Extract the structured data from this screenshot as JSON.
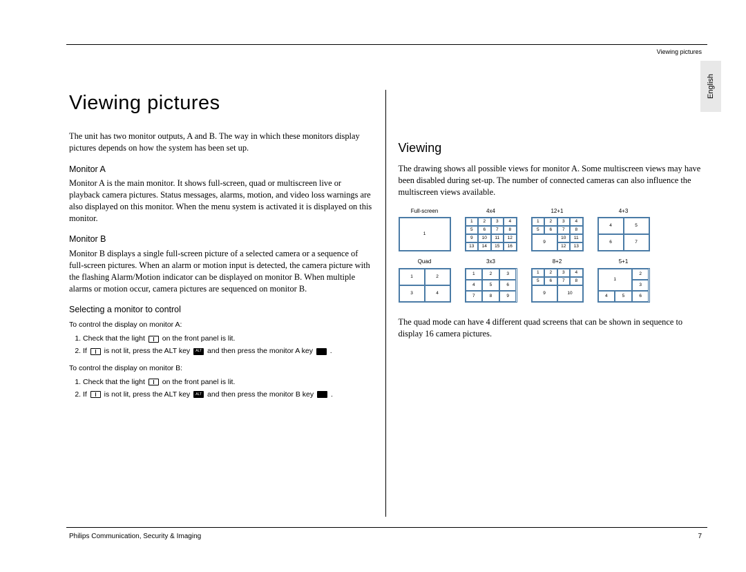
{
  "header": {
    "running": "Viewing pictures",
    "lang_tab": "English"
  },
  "left": {
    "h1": "Viewing pictures",
    "intro": "The unit has two monitor outputs, A and B. The way in which these monitors display pictures depends on how the system has been set up.",
    "ma": {
      "h": "Monitor A",
      "p": "Monitor A is the main monitor. It shows full-screen, quad or multiscreen live or playback camera pictures. Status messages, alarms, motion, and video loss warnings are also displayed on this monitor. When the menu system is activated it is displayed on this monitor."
    },
    "mb": {
      "h": "Monitor B",
      "p": "Monitor B displays a single full-screen picture of a selected camera or a sequence of full-screen pictures. When an alarm or motion input is detected, the camera picture with the flashing Alarm/Motion indicator can be displayed on monitor B. When multiple alarms or motion occur, camera pictures are sequenced on monitor B."
    },
    "sel": {
      "h": "Selecting a monitor to control",
      "a_lead": "To control the display on monitor A:",
      "a1_a": "Check that the light ",
      "a1_b": " on the front panel is lit.",
      "a2_a": "If ",
      "a2_b": " is not lit, press the ALT key ",
      "a2_c": " and then press the monitor A key ",
      "a2_d": " .",
      "b_lead": "To control the display on monitor B:",
      "b1_a": "Check that the light ",
      "b1_b": " on the front panel is lit.",
      "b2_a": "If ",
      "b2_b": " is not lit, press the ALT key ",
      "b2_c": " and then press the monitor B key ",
      "b2_d": " .",
      "alt_label": "ALT"
    }
  },
  "right": {
    "h2": "Viewing",
    "intro": "The drawing shows all possible views for monitor A. Some multiscreen views may have been disabled during set-up. The number of connected cameras can also influence the multiscreen views available.",
    "labels": {
      "fullscreen": "Full-screen",
      "quad": "Quad",
      "g4x4": "4x4",
      "g3x3": "3x3",
      "g12p1": "12+1",
      "g8p2": "8+2",
      "g4p3": "4+3",
      "g5p1": "5+1"
    },
    "quad_note": "The quad mode can have 4 different quad screens that can be shown in sequence to display 16 camera pictures."
  },
  "footer": {
    "left": "Philips Communication, Security & Imaging",
    "page": "7"
  }
}
